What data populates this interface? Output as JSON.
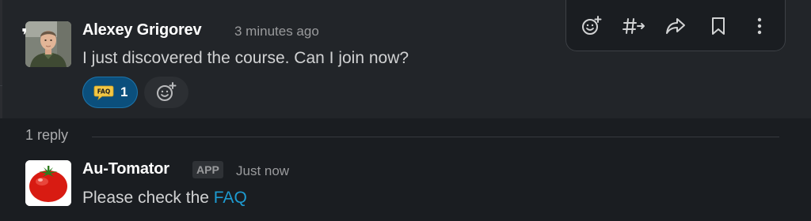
{
  "parent_message": {
    "author": "Alexey Grigorev",
    "timestamp": "3 minutes ago",
    "text": "I just discovered the course. Can I join now?",
    "avatar_icon": "user-photo",
    "reaction": {
      "emoji_label": "FAQ",
      "count": "1",
      "icon": "faq-speech-bubble-icon"
    },
    "add_reaction_icon": "add-emoji-icon"
  },
  "toolbar": {
    "items": [
      {
        "name": "add-reaction",
        "icon": "add-emoji-icon"
      },
      {
        "name": "reply-in-thread",
        "icon": "hash-arrow-icon"
      },
      {
        "name": "share-message",
        "icon": "share-arrow-icon"
      },
      {
        "name": "save-for-later",
        "icon": "bookmark-icon"
      },
      {
        "name": "more-actions",
        "icon": "vertical-ellipsis-icon"
      }
    ]
  },
  "thread": {
    "reply_count": "1 reply"
  },
  "reply_message": {
    "author": "Au-Tomator",
    "badge": "APP",
    "timestamp": "Just now",
    "text_prefix": "Please check the ",
    "link_text": "FAQ",
    "avatar_icon": "tomato-icon"
  },
  "colors": {
    "background": "#1a1d21",
    "hover_background": "#222529",
    "link": "#1d9bd1",
    "reaction_bg": "#0b4f7c",
    "faq_badge": "#f2c744"
  }
}
